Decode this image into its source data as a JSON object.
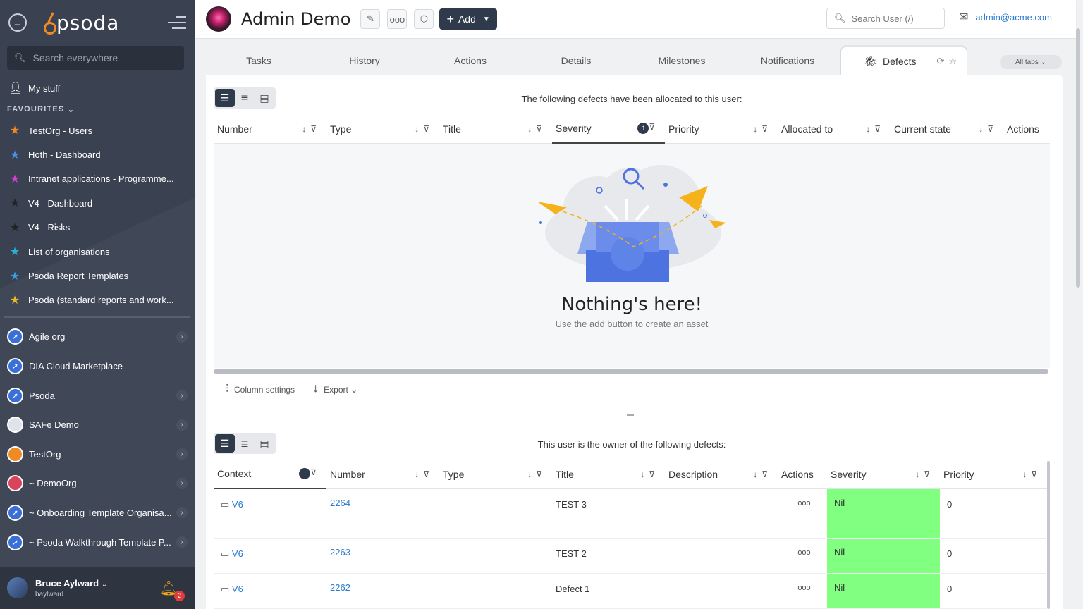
{
  "sidebar": {
    "logo": "psoda",
    "search_placeholder": "Search everywhere",
    "my_stuff": "My stuff",
    "favourites_header": "FAVOURITES",
    "favourites": [
      {
        "label": "TestOrg - Users",
        "color": "#f08a24"
      },
      {
        "label": "Hoth - Dashboard",
        "color": "#4a8fe7"
      },
      {
        "label": "Intranet applications - Programme...",
        "color": "#d63fcf"
      },
      {
        "label": "V4 - Dashboard",
        "color": "#222222"
      },
      {
        "label": "V4 - Risks",
        "color": "#222222"
      },
      {
        "label": "List of organisations",
        "color": "#2ab0d6"
      },
      {
        "label": "Psoda Report Templates",
        "color": "#3b9bdf"
      },
      {
        "label": "Psoda (standard reports and work...",
        "color": "#e8b92a"
      }
    ],
    "orgs": [
      {
        "label": "Agile org",
        "icon": "rocket-icon",
        "bg": "#3a6fd8",
        "chevron": true
      },
      {
        "label": "DIA Cloud Marketplace",
        "icon": "rocket-icon",
        "bg": "#3a6fd8",
        "chevron": false
      },
      {
        "label": "Psoda",
        "icon": "rocket-icon",
        "bg": "#3a6fd8",
        "chevron": true
      },
      {
        "label": "SAFe Demo",
        "icon": "safe-logo-icon",
        "bg": "#dfe3ea",
        "chevron": true
      },
      {
        "label": "TestOrg",
        "icon": "orange-circle-icon",
        "bg": "#f08a24",
        "chevron": true
      },
      {
        "label": "~ DemoOrg",
        "icon": "sunset-icon",
        "bg": "#d8455a",
        "chevron": true
      },
      {
        "label": "~ Onboarding Template Organisa...",
        "icon": "rocket-icon",
        "bg": "#3a6fd8",
        "chevron": true
      },
      {
        "label": "~ Psoda Walkthrough Template P...",
        "icon": "rocket-icon",
        "bg": "#3a6fd8",
        "chevron": true
      }
    ],
    "user": {
      "name": "Bruce Aylward",
      "username": "baylward",
      "notifications": "2"
    }
  },
  "header": {
    "title": "Admin Demo",
    "add_label": "Add",
    "search_placeholder": "Search User (/)",
    "email": "admin@acme.com"
  },
  "tabs": [
    "Tasks",
    "History",
    "Actions",
    "Details",
    "Milestones",
    "Notifications"
  ],
  "active_tab": "Defects",
  "all_tabs_label": "All tabs",
  "allocated": {
    "caption": "The following defects have been allocated to this user:",
    "columns": [
      "Number",
      "Type",
      "Title",
      "Severity",
      "Priority",
      "Allocated to",
      "Current state",
      "Actions"
    ],
    "empty_title": "Nothing's here!",
    "empty_sub": "Use the add button to create an asset"
  },
  "toolbar": {
    "column_settings": "Column settings",
    "export": "Export"
  },
  "owned": {
    "caption": "This user is the owner of the following defects:",
    "columns": [
      "Context",
      "Number",
      "Type",
      "Title",
      "Description",
      "Actions",
      "Severity",
      "Priority"
    ],
    "rows": [
      {
        "context": "V6",
        "number": "2264",
        "type": "",
        "title": "TEST 3",
        "description": "",
        "actions": "ooo",
        "severity": "Nil",
        "priority": "0"
      },
      {
        "context": "V6",
        "number": "2263",
        "type": "",
        "title": "TEST 2",
        "description": "",
        "actions": "ooo",
        "severity": "Nil",
        "priority": "0"
      },
      {
        "context": "V6",
        "number": "2262",
        "type": "",
        "title": "Defect 1",
        "description": "",
        "actions": "ooo",
        "severity": "Nil",
        "priority": "0"
      }
    ],
    "severity_color": "#80ff80"
  }
}
